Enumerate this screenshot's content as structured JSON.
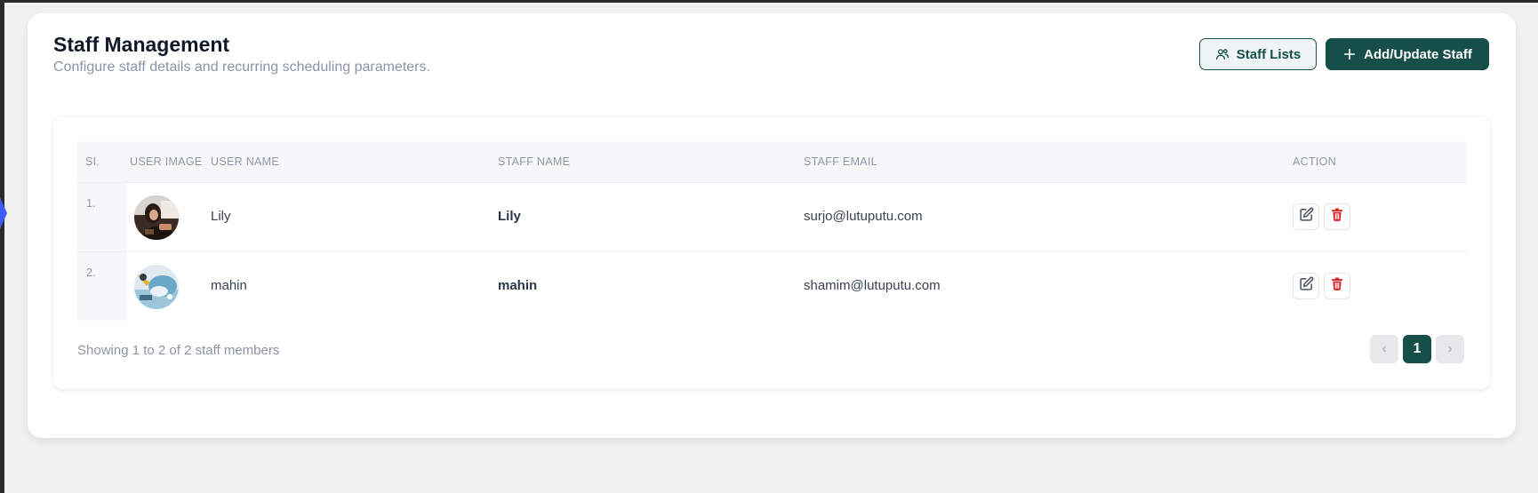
{
  "header": {
    "title": "Staff Management",
    "subtitle": "Configure staff details and recurring scheduling parameters."
  },
  "toolbar": {
    "staff_lists_label": "Staff Lists",
    "add_update_label": "Add/Update Staff",
    "staff_lists_icon": "users-icon",
    "add_icon": "plus-icon"
  },
  "table": {
    "columns": [
      "SI.",
      "USER IMAGE",
      "USER NAME",
      "STAFF NAME",
      "STAFF EMAIL",
      "ACTION"
    ],
    "rows": [
      {
        "sl": "1.",
        "user_name": "Lily",
        "staff_name": "Lily",
        "email": "surjo@lutuputu.com"
      },
      {
        "sl": "2.",
        "user_name": "mahin",
        "staff_name": "mahin",
        "email": "shamim@lutuputu.com"
      }
    ]
  },
  "footer": {
    "summary": "Showing 1 to 2 of 2 staff members"
  },
  "pagination": {
    "prev": "‹",
    "current": "1",
    "next": "›"
  },
  "colors": {
    "brand": "#164e49",
    "delete": "#dc2626",
    "edit": "#4b5563"
  }
}
